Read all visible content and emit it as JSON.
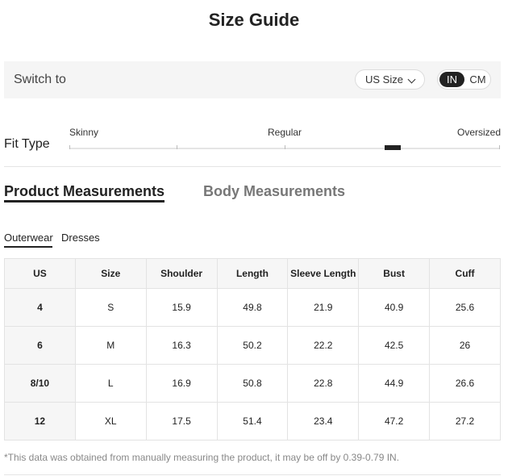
{
  "title": "Size Guide",
  "switch_bar": {
    "label": "Switch to",
    "size_select": "US Size",
    "units": {
      "in": "IN",
      "cm": "CM",
      "selected": "IN"
    }
  },
  "fit_type": {
    "label": "Fit Type",
    "scale": [
      "Skinny",
      "Regular",
      "Oversized"
    ],
    "marker_level": 0.75
  },
  "tabs": {
    "active": "Product Measurements",
    "inactive": "Body Measurements"
  },
  "subtabs": {
    "active": "Outerwear",
    "other": "Dresses"
  },
  "table": {
    "headers": [
      "US",
      "Size",
      "Shoulder",
      "Length",
      "Sleeve Length",
      "Bust",
      "Cuff"
    ],
    "rows": [
      [
        "4",
        "S",
        "15.9",
        "49.8",
        "21.9",
        "40.9",
        "25.6"
      ],
      [
        "6",
        "M",
        "16.3",
        "50.2",
        "22.2",
        "42.5",
        "26"
      ],
      [
        "8/10",
        "L",
        "16.9",
        "50.8",
        "22.8",
        "44.9",
        "26.6"
      ],
      [
        "12",
        "XL",
        "17.5",
        "51.4",
        "23.4",
        "47.2",
        "27.2"
      ]
    ]
  },
  "note": "*This data was obtained from manually measuring the product, it may be off by 0.39-0.79 IN."
}
